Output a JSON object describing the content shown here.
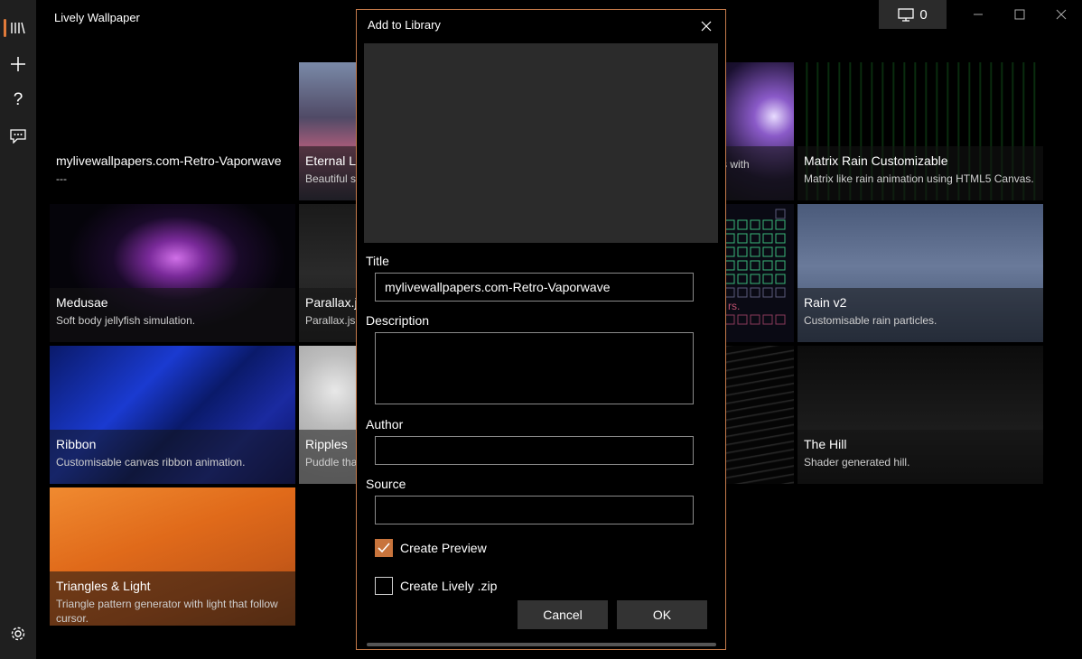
{
  "app": {
    "title": "Lively Wallpaper"
  },
  "titlebar": {
    "monitor_count": "0"
  },
  "sidebar": {
    "items": [
      "library-icon",
      "add-icon",
      "help-icon",
      "feedback-icon",
      "settings-icon"
    ]
  },
  "library": {
    "tiles": [
      {
        "title": "mylivewallpapers.com-Retro-Vaporwave",
        "desc": "---"
      },
      {
        "title": "Eternal Li",
        "desc": "Beautiful s"
      },
      {
        "title": "",
        "desc": "s with"
      },
      {
        "title": "Matrix Rain Customizable",
        "desc": "Matrix like rain animation using HTML5 Canvas."
      },
      {
        "title": "Medusae",
        "desc": "Soft body jellyfish simulation."
      },
      {
        "title": "Parallax.js",
        "desc": "Parallax.js"
      },
      {
        "title": "",
        "desc": "rs."
      },
      {
        "title": "Rain v2",
        "desc": "Customisable rain particles."
      },
      {
        "title": "Ribbon",
        "desc": "Customisable canvas ribbon animation."
      },
      {
        "title": "Ripples",
        "desc": "Puddle tha"
      },
      {
        "title": "",
        "desc": ""
      },
      {
        "title": "The Hill",
        "desc": "Shader generated hill."
      },
      {
        "title": "Triangles & Light",
        "desc": "Triangle pattern generator with light that follow cursor."
      }
    ]
  },
  "dialog": {
    "title": "Add to Library",
    "title_label": "Title",
    "title_value": "mylivewallpapers.com-Retro-Vaporwave",
    "description_label": "Description",
    "description_value": "",
    "author_label": "Author",
    "author_value": "",
    "source_label": "Source",
    "source_value": "",
    "create_preview_label": "Create Preview",
    "create_preview_checked": true,
    "create_zip_label": "Create Lively .zip",
    "create_zip_checked": false,
    "cancel_label": "Cancel",
    "ok_label": "OK"
  },
  "colors": {
    "accent": "#c8743c",
    "sidebar": "#1f1f1f",
    "preview": "#2b2b2b"
  }
}
